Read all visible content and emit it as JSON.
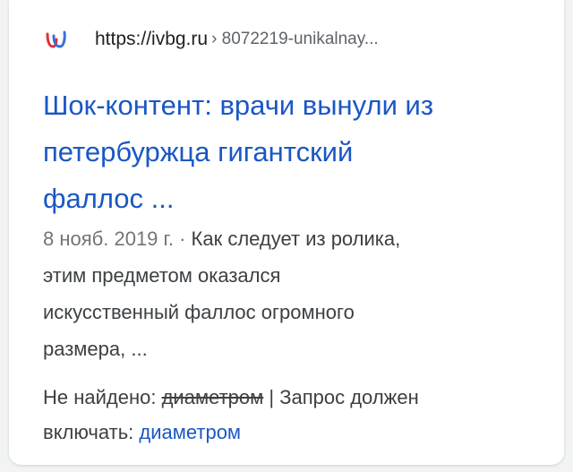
{
  "result": {
    "url_domain": "https://ivbg.ru",
    "url_path": "› 8072219-unikalnay...",
    "title_lines": [
      "Шок-контент: врачи вынули из",
      "петербуржца гигантский",
      "фаллос ..."
    ],
    "date": "8 нояб. 2019 г.",
    "separator": " · ",
    "snippet_lines": [
      "Как следует из ролика,",
      "этим предметом оказался",
      "искусственный фаллос огромного",
      "размера, ..."
    ],
    "missing_label": "Не найдено: ",
    "missing_term": "диаметром",
    "must_include_text": " | Запрос должен",
    "must_include_label": "включать: ",
    "must_include_term": "диаметром"
  },
  "colors": {
    "link": "#1a57c5",
    "text": "#3c4043",
    "muted": "#70757a",
    "background": "#f1f3f4",
    "favicon_red": "#e0303a",
    "favicon_blue": "#3a6fd8"
  },
  "icons": {
    "favicon": "ivbg-logo-icon"
  }
}
